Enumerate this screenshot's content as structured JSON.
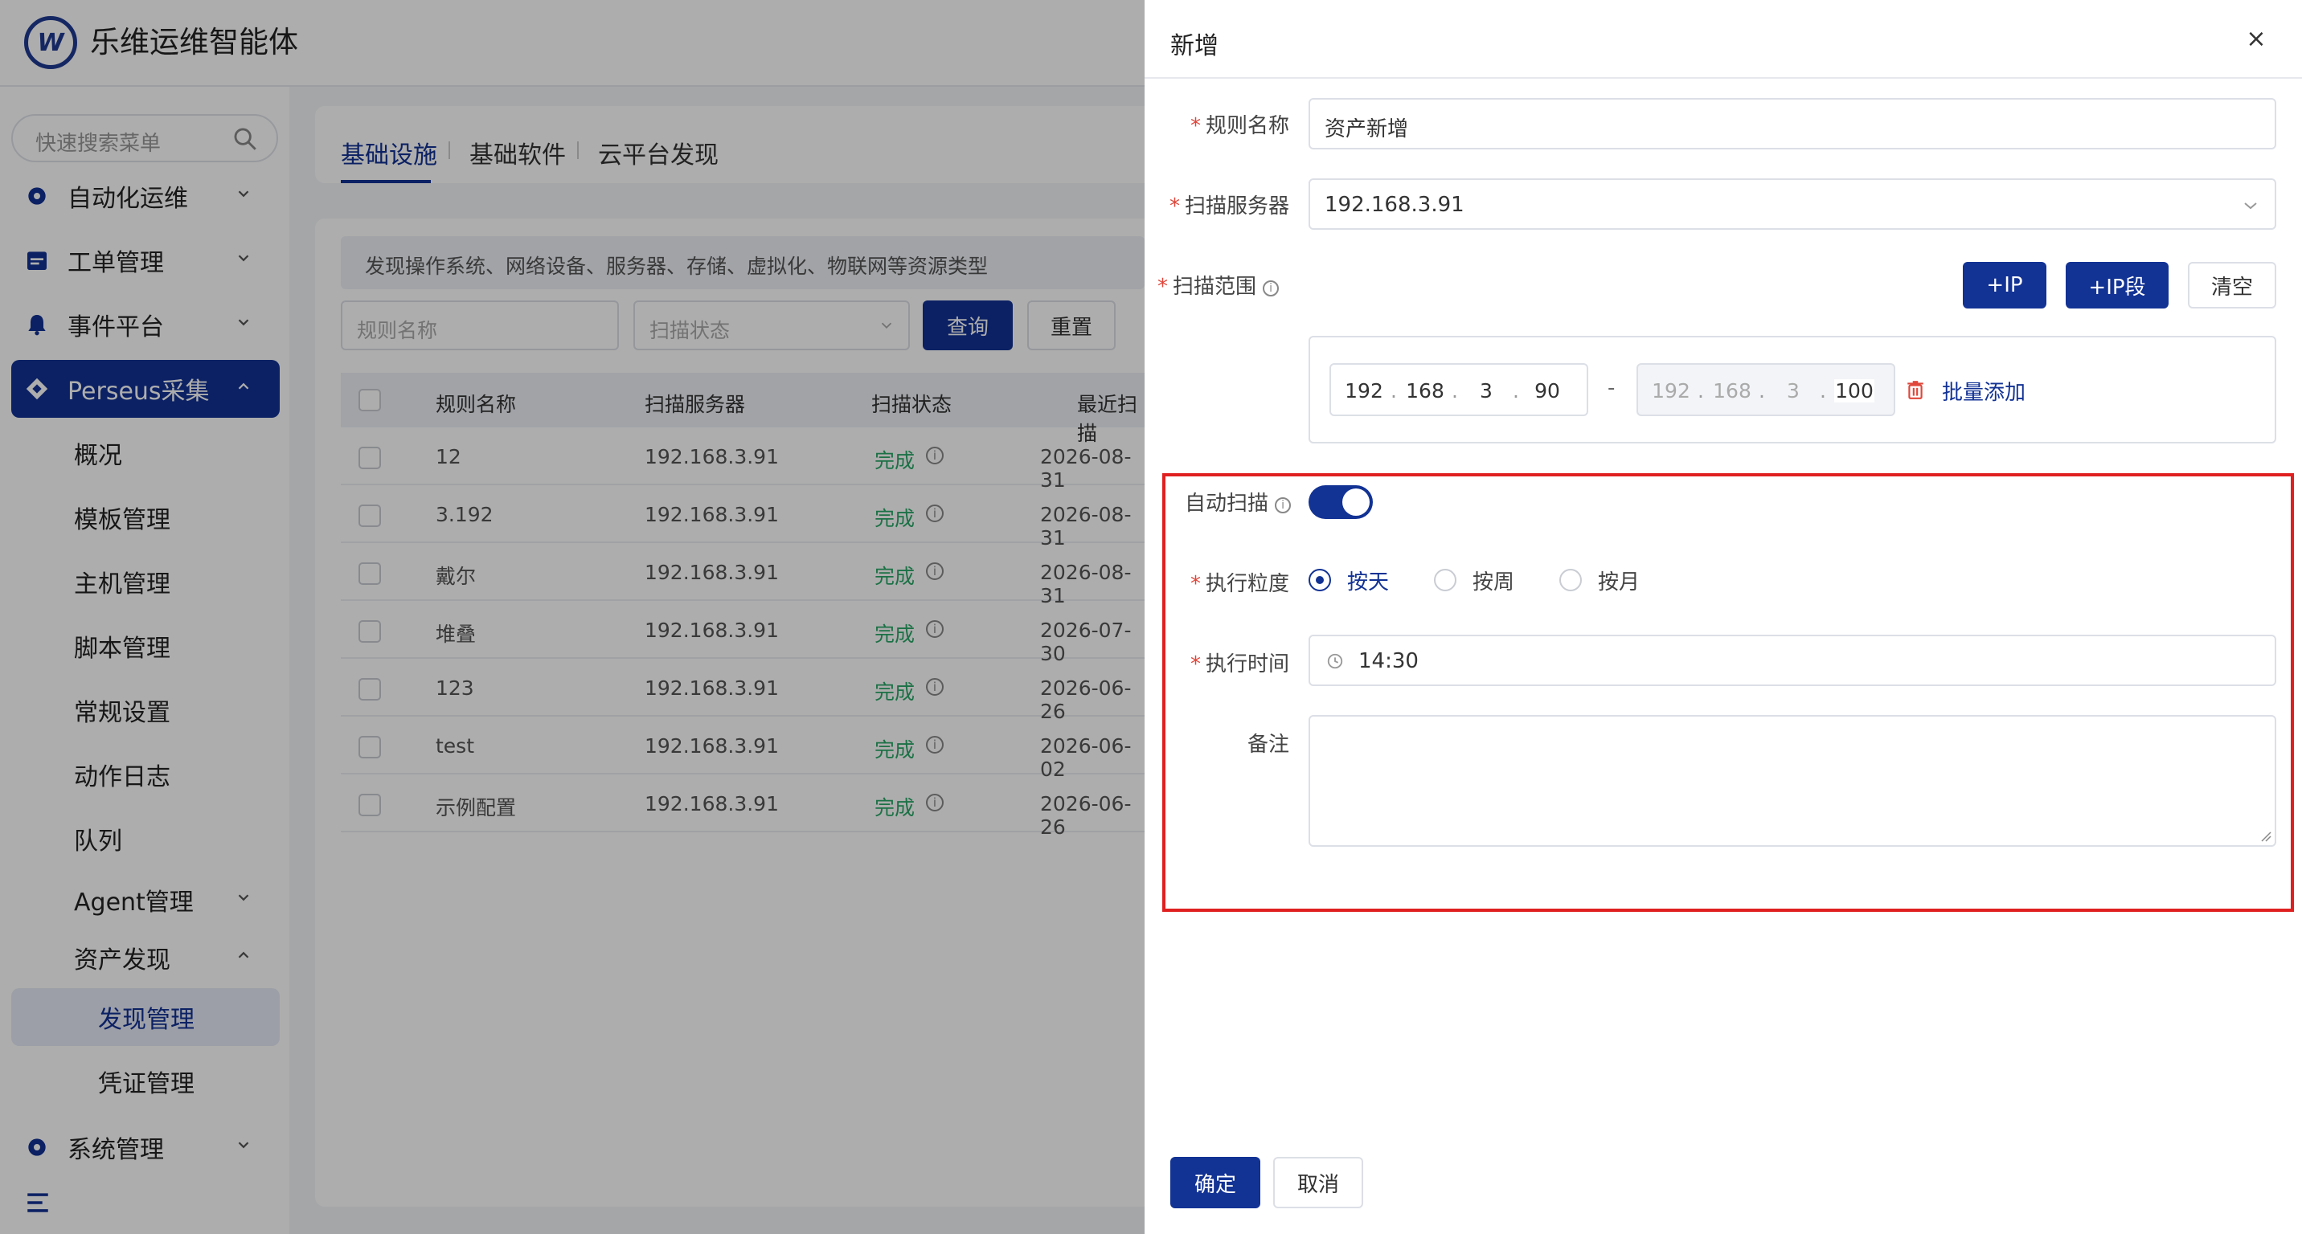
{
  "app": {
    "title": "乐维运维智能体",
    "logo_letter": "W"
  },
  "sidebar": {
    "search_placeholder": "快速搜索菜单",
    "items": [
      {
        "label": "自动化运维",
        "icon": "gear-icon"
      },
      {
        "label": "工单管理",
        "icon": "calendar-icon"
      },
      {
        "label": "事件平台",
        "icon": "bell-icon"
      },
      {
        "label": "Perseus采集",
        "icon": "diamond-icon"
      },
      {
        "label": "概况"
      },
      {
        "label": "模板管理"
      },
      {
        "label": "主机管理"
      },
      {
        "label": "脚本管理"
      },
      {
        "label": "常规设置"
      },
      {
        "label": "动作日志"
      },
      {
        "label": "队列"
      },
      {
        "label": "Agent管理"
      },
      {
        "label": "资产发现"
      },
      {
        "label": "发现管理"
      },
      {
        "label": "凭证管理"
      },
      {
        "label": "系统管理",
        "icon": "gear-icon"
      }
    ]
  },
  "main": {
    "tabs": [
      "基础设施",
      "基础软件",
      "云平台发现"
    ],
    "description": "发现操作系统、网络设备、服务器、存储、虚拟化、物联网等资源类型",
    "filter": {
      "name_placeholder": "规则名称",
      "status_placeholder": "扫描状态",
      "query": "查询",
      "reset": "重置"
    },
    "table": {
      "columns": [
        "规则名称",
        "扫描服务器",
        "扫描状态",
        "最近扫描"
      ],
      "rows": [
        {
          "name": "12",
          "server": "192.168.3.91",
          "status": "完成",
          "last": "2026-08-31"
        },
        {
          "name": "3.192",
          "server": "192.168.3.91",
          "status": "完成",
          "last": "2026-08-31"
        },
        {
          "name": "戴尔",
          "server": "192.168.3.91",
          "status": "完成",
          "last": "2026-08-31"
        },
        {
          "name": "堆叠",
          "server": "192.168.3.91",
          "status": "完成",
          "last": "2026-07-30"
        },
        {
          "name": "123",
          "server": "192.168.3.91",
          "status": "完成",
          "last": "2026-06-26"
        },
        {
          "name": "test",
          "server": "192.168.3.91",
          "status": "完成",
          "last": "2026-06-02"
        },
        {
          "name": "示例配置",
          "server": "192.168.3.91",
          "status": "完成",
          "last": "2026-06-26"
        }
      ]
    }
  },
  "drawer": {
    "title": "新增",
    "close": "×",
    "rule_name_label": "规则名称",
    "rule_name_value": "资产新增",
    "server_label": "扫描服务器",
    "server_value": "192.168.3.91",
    "range_label": "扫描范围",
    "add_ip": "+IP",
    "add_ip_range": "+IP段",
    "clear": "清空",
    "ip_from": [
      "192",
      "168",
      "3",
      "90"
    ],
    "ip_to": [
      "192",
      "168",
      "3",
      "100"
    ],
    "range_separator": "-",
    "batch_add": "批量添加",
    "auto_scan_label": "自动扫描",
    "auto_scan_on": true,
    "granularity_label": "执行粒度",
    "granularity_options": [
      "按天",
      "按周",
      "按月"
    ],
    "granularity_selected": "按天",
    "time_label": "执行时间",
    "time_value": "14:30",
    "remark_label": "备注",
    "confirm": "确定",
    "cancel": "取消"
  },
  "colors": {
    "primary": "#123294",
    "success": "#2aa768",
    "required": "#e0463a",
    "highlight": "#e02020"
  }
}
